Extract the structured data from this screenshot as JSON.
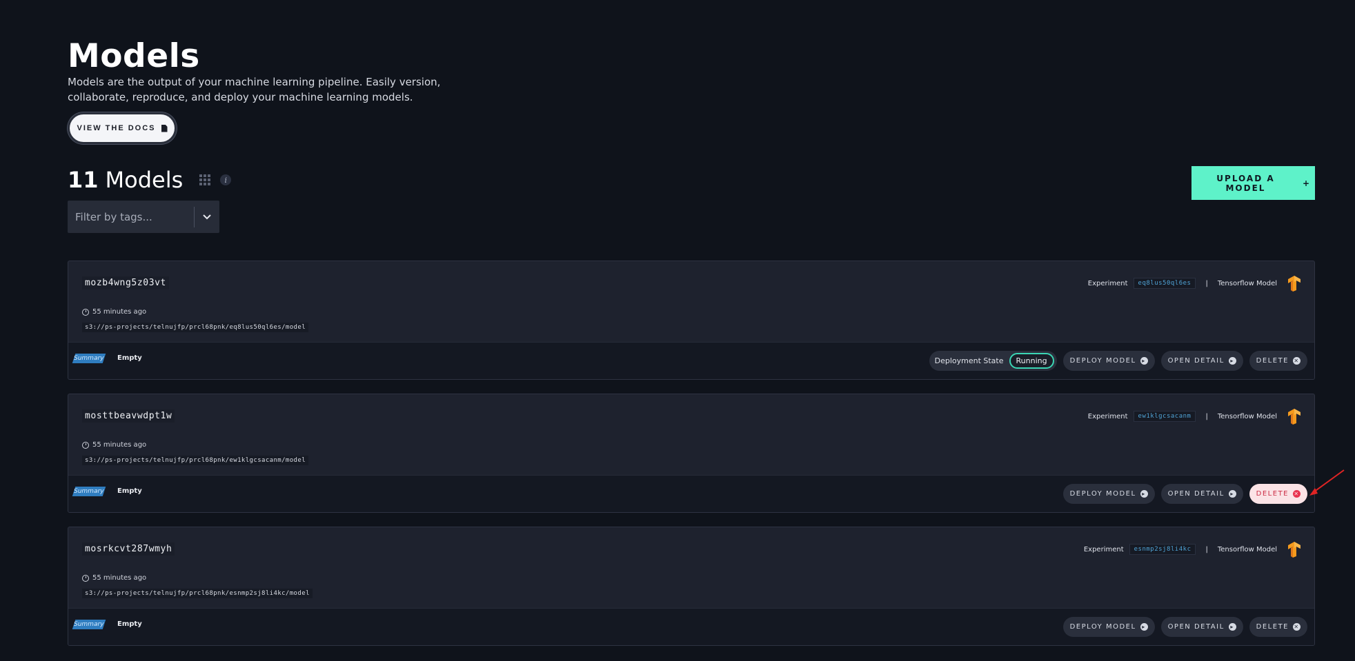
{
  "header": {
    "title": "Models",
    "description": "Models are the output of your machine learning pipeline. Easily version, collaborate, reproduce, and deploy your machine learning models.",
    "docs_button": "VIEW THE DOCS"
  },
  "toolbar": {
    "count": "11",
    "count_label": "Models",
    "info_label": "i",
    "filter_placeholder": "Filter by tags...",
    "upload_button": "UPLOAD A MODEL",
    "upload_icon": "+"
  },
  "labels": {
    "experiment": "Experiment",
    "model_type": "Tensorflow Model",
    "separator": "|",
    "tag": "Summary",
    "tag_value": "Empty",
    "deployment_state": "Deployment State",
    "deploy": "DEPLOY MODEL",
    "open": "OPEN DETAIL",
    "delete": "DELETE"
  },
  "models": [
    {
      "id": "mozb4wng5z03vt",
      "time": "55 minutes ago",
      "path": "s3://ps-projects/telnujfp/prcl68pnk/eq8lus50ql6es/model",
      "experiment": "eq8lus50ql6es",
      "deployment_status": "Running"
    },
    {
      "id": "mosttbeavwdpt1w",
      "time": "55 minutes ago",
      "path": "s3://ps-projects/telnujfp/prcl68pnk/ew1klgcsacanm/model",
      "experiment": "ew1klgcsacanm",
      "deployment_status": null
    },
    {
      "id": "mosrkcvt287wmyh",
      "time": "55 minutes ago",
      "path": "s3://ps-projects/telnujfp/prcl68pnk/esnmp2sj8li4kc/model",
      "experiment": "esnmp2sj8li4kc",
      "deployment_status": null
    }
  ],
  "colors": {
    "background": "#0f131b",
    "accent": "#5ef2c9",
    "danger": "#e8334f",
    "running": "#3bd6b4",
    "tag": "#2f7dc0"
  },
  "icons": {
    "docs": "document-icon",
    "count_view": "grid-icon",
    "info": "info-icon",
    "filter": "chevron-down-icon",
    "model": "tensorflow-icon",
    "time": "clock-icon",
    "action": "arrow-circle-right-icon",
    "delete": "close-circle-icon",
    "annotation": "red-arrow-icon"
  }
}
